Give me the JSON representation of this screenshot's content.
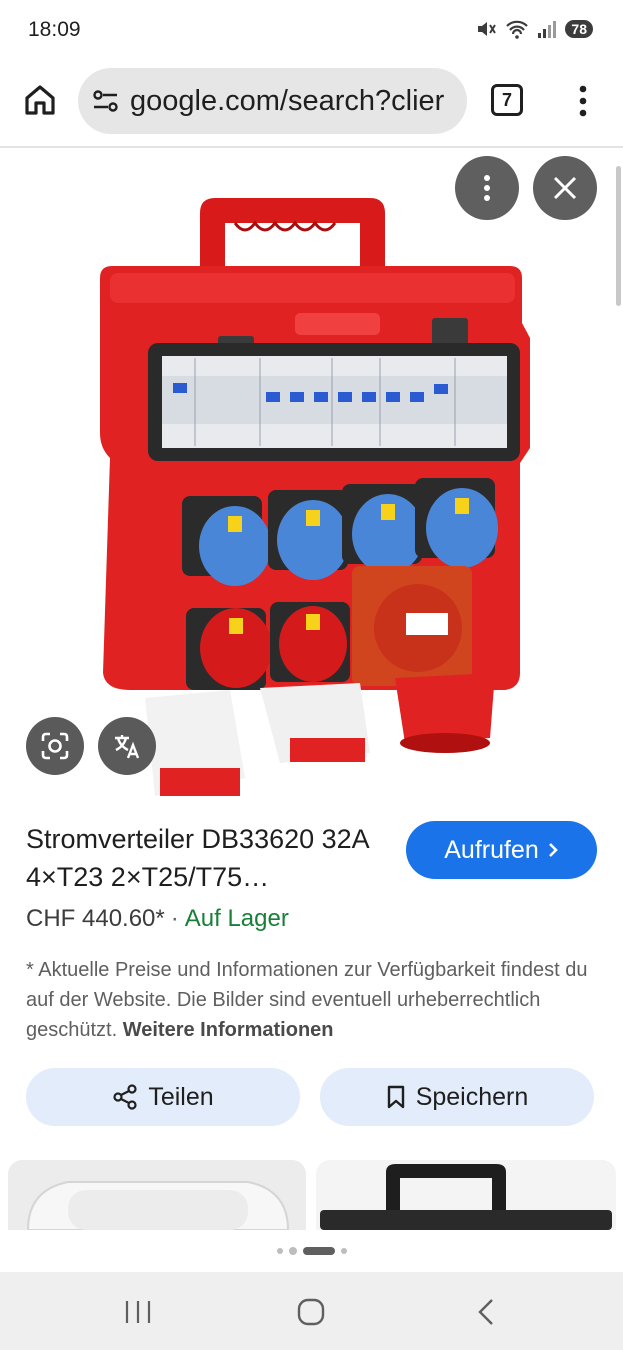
{
  "status": {
    "time": "18:09",
    "battery": "78",
    "icons": [
      "mute-icon",
      "wifi-icon",
      "signal-icon",
      "battery-icon"
    ]
  },
  "browser": {
    "url": "google.com/search?clier",
    "tab_count": "7"
  },
  "viewer": {
    "image_alt": "Stromverteiler DB33620 product photo"
  },
  "product": {
    "title": "Stromverteiler DB33620 32A 4×T23 2×T25/T75…",
    "visit_label": "Aufrufen",
    "price": "CHF 440.60*",
    "separator": "·",
    "stock": "Auf Lager",
    "disclaimer": "* Aktuelle Preise und Informationen zur Verfügbarkeit findest du auf der Website. Die Bilder sind eventuell urheberrechtlich geschützt.",
    "more_info": "Weitere Informationen"
  },
  "actions": {
    "share_label": "Teilen",
    "save_label": "Speichern"
  },
  "colors": {
    "accent": "#1a73e8",
    "stock_green": "#188038",
    "product_red": "#e02020",
    "socket_blue": "#4a86d8"
  }
}
